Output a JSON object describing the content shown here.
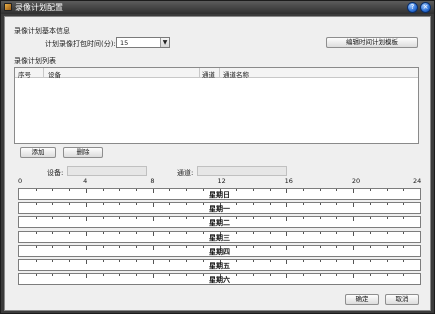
{
  "window": {
    "title": "录像计划配置",
    "help_glyph": "?",
    "close_glyph": "×",
    "app_icon": "recorder-app-icon"
  },
  "basic": {
    "group_title": "录像计划基本信息",
    "pack_time_label": "计划录像打包时间(分):",
    "pack_time_value": "15",
    "edit_template_button": "编辑时间计划模板"
  },
  "plan_list": {
    "group_title": "录像计划列表",
    "columns": [
      "序号",
      "设备",
      "通道",
      "通道名称"
    ],
    "rows": []
  },
  "actions": {
    "add_button": "添加",
    "delete_button": "删除"
  },
  "selection": {
    "device_label": "设备:",
    "device_value": "",
    "channel_label": "通道:",
    "channel_value": ""
  },
  "timeline": {
    "scale": [
      "0",
      "4",
      "8",
      "12",
      "16",
      "20",
      "24"
    ],
    "days": [
      "星期日",
      "星期一",
      "星期二",
      "星期三",
      "星期四",
      "星期五",
      "星期六"
    ]
  },
  "footer": {
    "ok_button": "确定",
    "cancel_button": "取消"
  }
}
